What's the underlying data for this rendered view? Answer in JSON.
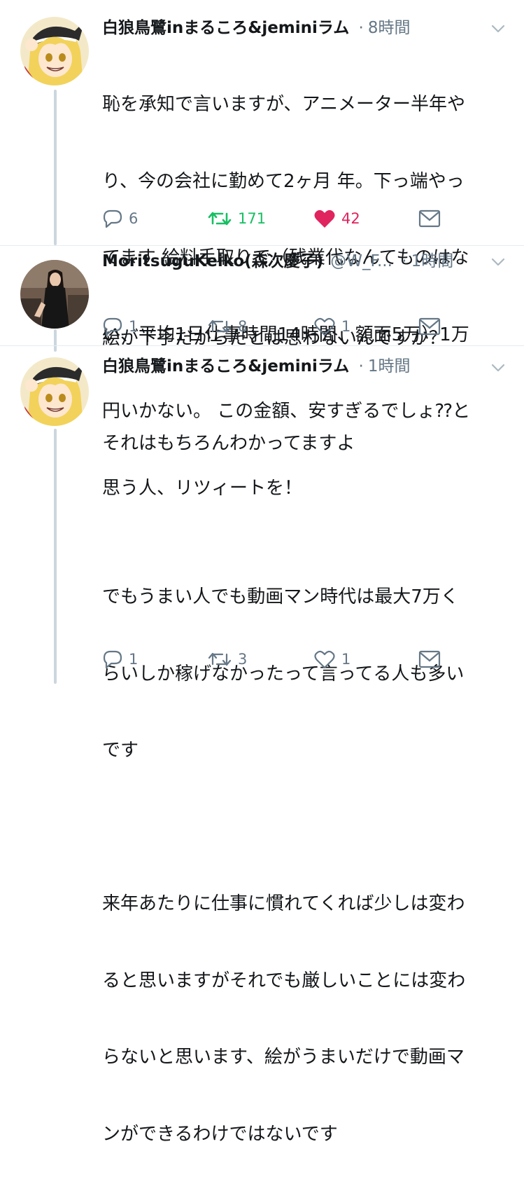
{
  "tweets": [
    {
      "author_name": "白狼鳥鷺inまるころ&jeminiラム",
      "handle": "",
      "separator": "·",
      "time": "8時間",
      "avatar_icon": "anime-girl-blonde-avatar",
      "text": "恥を承知で言いますが、アニメーター半年やり、今の会社に勤めて2ヶ月 年。下っ端やってます 給料手取りで（残業代なんてものはない、平均1日仕事時間14時間、額面5万）1万円いかない。 この金額、安すぎるでしょ⁇と思う人、リツィートを！",
      "lines": [
        "恥を承知で言いますが、アニメーター半年や",
        "り、今の会社に勤めて2ヶ月 年。下っ端やっ",
        "てます 給料手取りで（残業代なんてものはな",
        "い、平均1日仕事時間14時間、額面5万）1万",
        "円いかない。 この金額、安すぎるでしょ⁇と",
        "思う人、リツィートを！"
      ],
      "replies": "6",
      "retweets": "171",
      "likes": "42",
      "retweeted": true,
      "liked": true,
      "colors": {
        "retweet_active": "#17bf63",
        "like_active": "#e0245e",
        "icon": "#657786"
      }
    },
    {
      "author_name": "MoritsuguKeiko(森次慶子)",
      "handle": "@W_F...",
      "separator": "·",
      "time": "1時間",
      "avatar_icon": "woman-photo-avatar",
      "text": "絵が下手だからだとは思わないんですか？",
      "lines": [
        "絵が下手だからだとは思わないんですか？"
      ],
      "replies": "1",
      "retweets": "8",
      "likes": "1",
      "retweeted": false,
      "liked": false
    },
    {
      "author_name": "白狼鳥鷺inまるころ&jeminiラム",
      "handle": "",
      "separator": "·",
      "time": "1時間",
      "avatar_icon": "anime-girl-blonde-avatar",
      "text": "それはもちろんわかってますよ\n\nでもうまい人でも動画マン時代は最大7万くらいしか稼げなかったって言ってる人も多いです\n\n来年あたりに仕事に慣れてくれば少しは変わると思いますがそれでも厳しいことには変わらないと思います、絵がうまいだけで動画マンができるわけではないです",
      "lines": [
        "それはもちろんわかってますよ",
        "",
        "でもうまい人でも動画マン時代は最大7万く",
        "らいしか稼げなかったって言ってる人も多い",
        "です",
        "",
        "来年あたりに仕事に慣れてくれば少しは変わ",
        "ると思いますがそれでも厳しいことには変わ",
        "らないと思います、絵がうまいだけで動画マ",
        "ンができるわけではないです"
      ],
      "replies": "1",
      "retweets": "3",
      "likes": "1",
      "retweeted": false,
      "liked": false
    }
  ]
}
